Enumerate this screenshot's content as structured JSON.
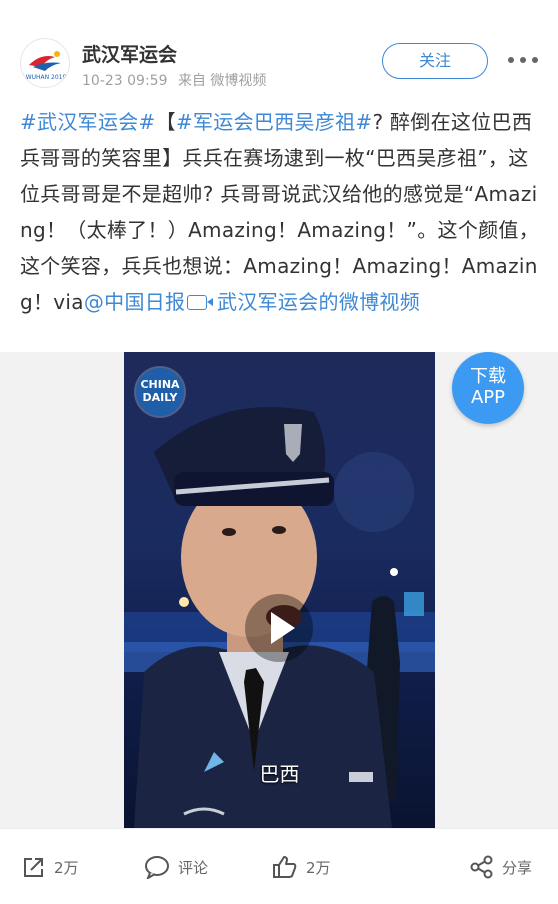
{
  "account": {
    "name": "武汉军运会",
    "time": "10-23 09:59",
    "source": "来自 微博视频",
    "follow_label": "关注",
    "logo_text": "WUHAN 2019"
  },
  "post": {
    "tag1": "#武汉军运会#",
    "bracket_open": "【",
    "tag2": "#军运会巴西吴彦祖#",
    "text1": "? 醉倒在这位巴西兵哥哥的笑容里】兵兵在赛场逮到一枚“巴西吴彦祖”，这位兵哥哥是不是超帅? 兵哥哥说武汉给他的感觉是“Amazing！（太棒了！）Amazing！Amazing！”。这个颜值，这个笑容，兵兵也想说：Amazing！Amazing！Amazing！via",
    "mention": "@中国日报",
    "video_link": "武汉军运会的微博视频"
  },
  "video": {
    "watermark": "CHINA DAILY",
    "subtitle": "巴西",
    "download_line1": "下载",
    "download_line2": "APP"
  },
  "actions": {
    "repost_count": "2万",
    "comment_label": "评论",
    "like_count": "2万",
    "share_label": "分享"
  },
  "colors": {
    "link": "#3e88d5",
    "download": "#3d9af2"
  }
}
